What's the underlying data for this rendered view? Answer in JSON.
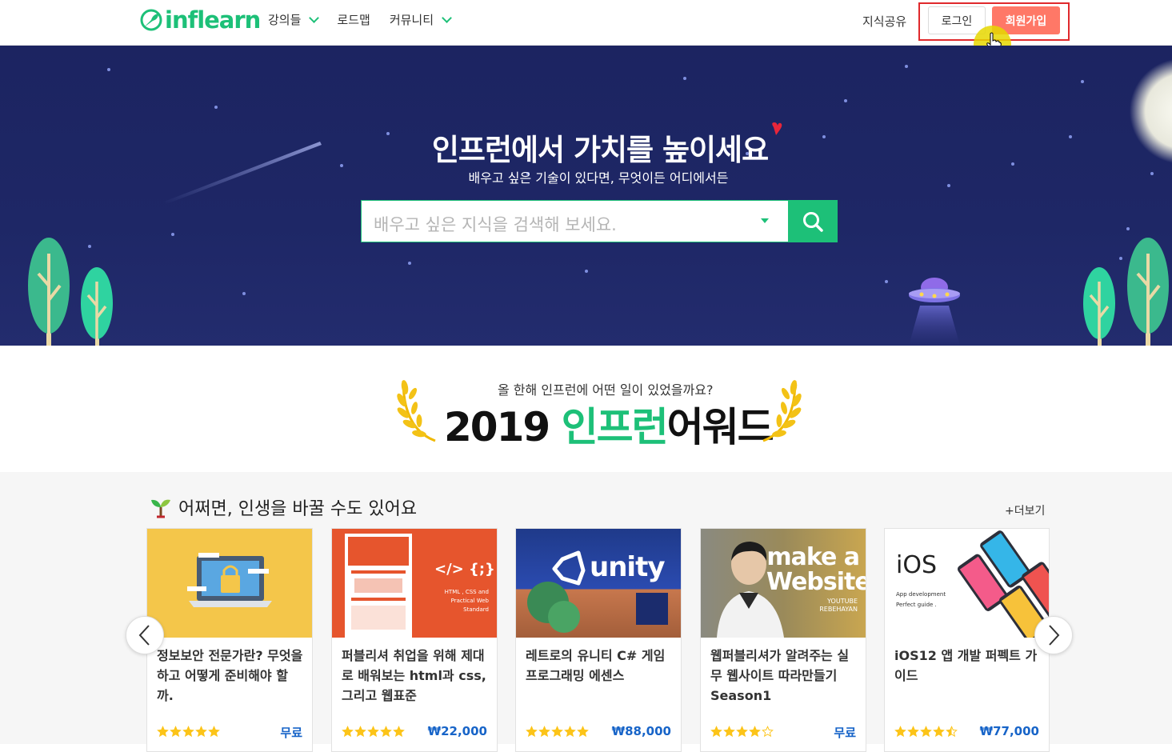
{
  "header": {
    "logo_text": "inflearn",
    "nav": [
      {
        "label": "강의들",
        "dropdown": true
      },
      {
        "label": "로드맵",
        "dropdown": false
      },
      {
        "label": "커뮤니티",
        "dropdown": true
      }
    ],
    "share_label": "지식공유",
    "login_label": "로그인",
    "signup_label": "회원가입"
  },
  "hero": {
    "title": "인프런에서 가치를 높이세요",
    "subtitle": "배우고 싶은 기술이 있다면, 무엇이든 어디에서든",
    "search_placeholder": "배우고 싶은 지식을 검색해 보세요."
  },
  "award": {
    "subtitle": "올 한해 인프런에 어떤 일이 있었을까요?",
    "year": "2019",
    "brand": "인프런",
    "title_suffix": "어워드"
  },
  "courses": {
    "section_title": "어쩌면, 인생을 바꿀 수도 있어요",
    "more_label": "+더보기",
    "items": [
      {
        "title": "정보보안 전문가란? 무엇을 하고 어떻게 준비해야 할까.",
        "price": "무료",
        "rating": 5,
        "thumb_text": ""
      },
      {
        "title": "퍼블리셔 취업을 위해 제대로 배워보는 html과 css, 그리고 웹표준",
        "price": "₩22,000",
        "rating": 5,
        "thumb_text": "</> {;}",
        "thumb_sub": "HTML , CSS and Practical Web Standard"
      },
      {
        "title": "레트로의 유니티 C# 게임 프로그래밍 에센스",
        "price": "₩88,000",
        "rating": 5,
        "thumb_text": "unity"
      },
      {
        "title": "웹퍼블리셔가 알려주는 실무 웹사이트 따라만들기 Season1",
        "price": "무료",
        "rating": 4,
        "thumb_text": "make a Website",
        "thumb_sub": "YOUTUBE REBEHAYAN"
      },
      {
        "title": "iOS12 앱 개발 퍼펙트 가이드",
        "price": "₩77,000",
        "rating": 4.5,
        "thumb_text": "iOS",
        "thumb_sub": "App development Perfect guide ."
      }
    ]
  },
  "colors": {
    "brand_green": "#1dc078",
    "signup": "#ff7867",
    "hero_bg": "#1e2766",
    "price_blue": "#1764c8",
    "star": "#fcc419"
  }
}
